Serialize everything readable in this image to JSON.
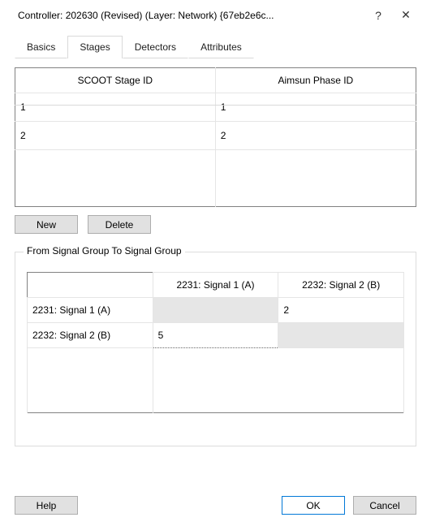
{
  "titlebar": {
    "title": "Controller: 202630 (Revised) (Layer: Network) {67eb2e6c..."
  },
  "tabs": {
    "items": [
      {
        "label": "Basics"
      },
      {
        "label": "Stages"
      },
      {
        "label": "Detectors"
      },
      {
        "label": "Attributes"
      }
    ],
    "activeIndex": 1
  },
  "stage_table": {
    "headers": {
      "col1": "SCOOT Stage ID",
      "col2": "Aimsun Phase ID"
    },
    "rows": [
      {
        "scoot": "1",
        "aimsun": "1"
      },
      {
        "scoot": "2",
        "aimsun": "2"
      }
    ]
  },
  "buttons": {
    "new": "New",
    "delete": "Delete"
  },
  "groupbox": {
    "label": "From Signal Group To Signal Group",
    "col_headers": [
      "2231: Signal 1 (A)",
      "2232: Signal 2 (B)"
    ],
    "row_headers": [
      "2231: Signal 1 (A)",
      "2232: Signal 2 (B)"
    ],
    "cells": {
      "r0c0": "",
      "r0c1": "2",
      "r1c0": "5",
      "r1c1": ""
    }
  },
  "footer": {
    "help": "Help",
    "ok": "OK",
    "cancel": "Cancel"
  }
}
